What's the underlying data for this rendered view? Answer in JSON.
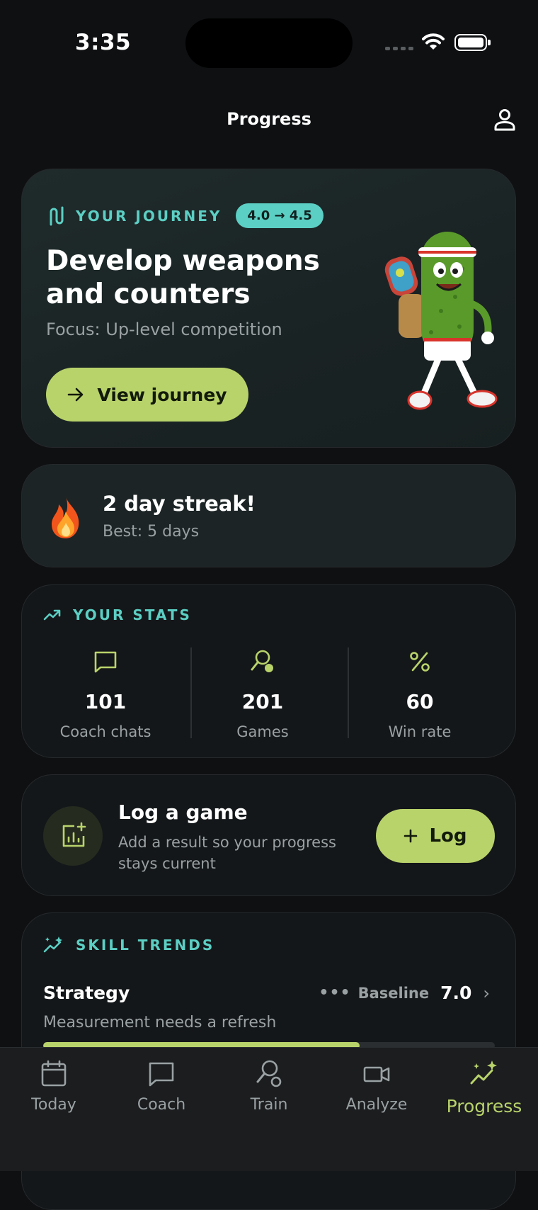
{
  "status_bar": {
    "time": "3:35"
  },
  "header": {
    "title": "Progress",
    "profile_icon": "person-icon"
  },
  "journey": {
    "label": "YOUR JOURNEY",
    "level": "4.0 → 4.5",
    "title": "Develop weapons and counters",
    "focus": "Focus: Up-level competition",
    "button_label": "View journey"
  },
  "streak": {
    "title": "2 day streak!",
    "best": "Best: 5 days"
  },
  "stats": {
    "label": "YOUR STATS",
    "items": [
      {
        "value": "101",
        "label": "Coach chats",
        "icon": "chat-icon"
      },
      {
        "value": "201",
        "label": "Games",
        "icon": "racket-icon"
      },
      {
        "value": "60",
        "label": "Win rate",
        "icon": "percent-icon"
      }
    ]
  },
  "log_game": {
    "title": "Log a game",
    "subtitle": "Add a result so your progress stays current",
    "button_label": "Log"
  },
  "skill_trends": {
    "label": "SKILL TRENDS",
    "skills": [
      {
        "name": "Strategy",
        "status": "Baseline",
        "score": "7.0",
        "note": "Measurement needs a refresh",
        "progress": 0.7
      }
    ]
  },
  "tabs": [
    {
      "label": "Today",
      "icon": "calendar-icon",
      "active": false
    },
    {
      "label": "Coach",
      "icon": "chat-icon",
      "active": false
    },
    {
      "label": "Train",
      "icon": "racket-icon",
      "active": false
    },
    {
      "label": "Analyze",
      "icon": "video-icon",
      "active": false
    },
    {
      "label": "Progress",
      "icon": "trend-sparkle-icon",
      "active": true
    }
  ],
  "colors": {
    "accent_lime": "#b9d36b",
    "accent_teal": "#5ccfc4",
    "background": "#0e1012"
  }
}
